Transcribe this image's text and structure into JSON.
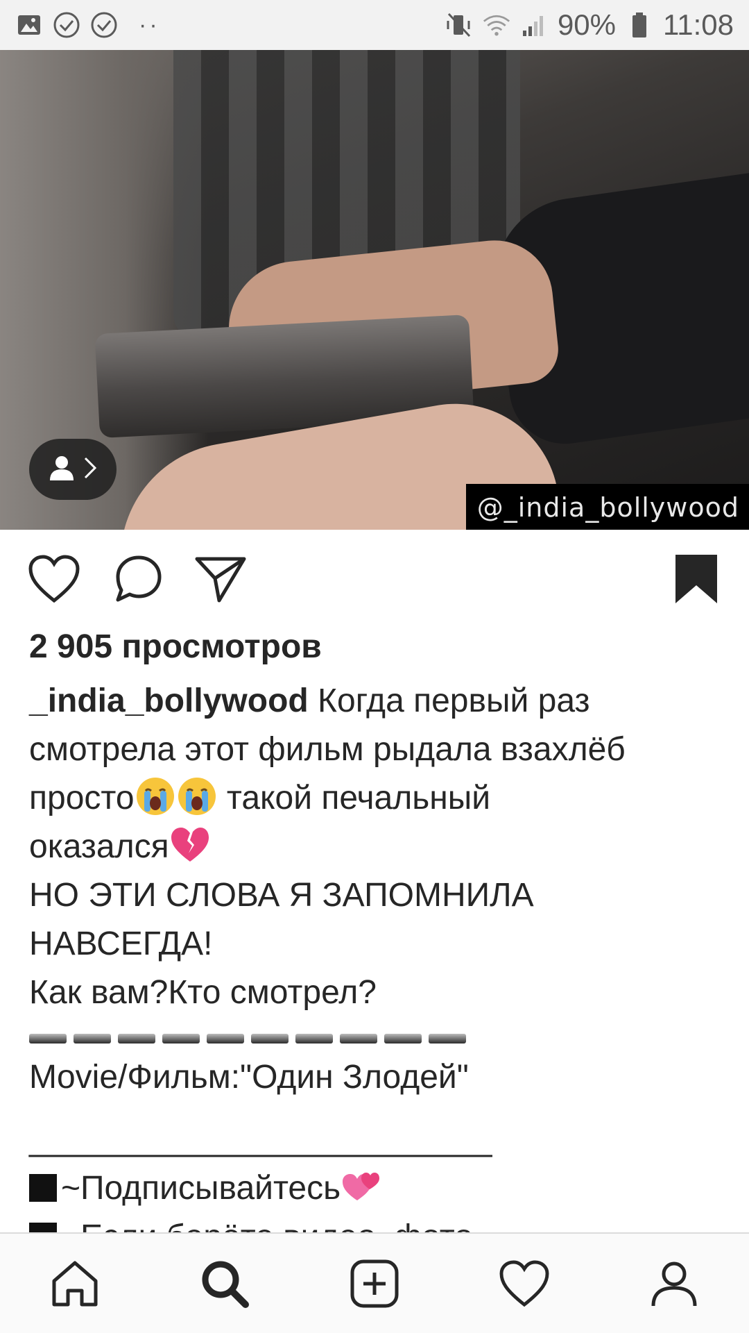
{
  "status_bar": {
    "battery": "90%",
    "time": "11:08",
    "left_icons": [
      "image-icon",
      "check-circle-icon",
      "check-circle-icon",
      "more-dots-icon"
    ],
    "right_icons": [
      "mute-vibrate-icon",
      "wifi-icon",
      "signal-icon",
      "battery-icon"
    ]
  },
  "post": {
    "watermark": "@_india_bollywood",
    "views": "2 905 просмотров",
    "username": "_india_bollywood",
    "caption_lines": [
      "Когда первый раз",
      "смотрела этот фильм рыдала взахлёб",
      "просто",
      " такой печальный",
      "оказался",
      "НО ЭТИ СЛОВА Я ЗАПОМНИЛА",
      "НАВСЕГДА!",
      "Как вам?Кто смотрел?",
      "Movie/Фильм:\"Один Злодей\"",
      "_________________________",
      "~Подписывайтесь",
      "~Если берёте видео, фото"
    ],
    "emojis": [
      "crying-face-emoji",
      "crying-face-emoji",
      "broken-heart-emoji",
      "hearts-emoji"
    ]
  },
  "actions": [
    "like-icon",
    "comment-icon",
    "share-icon",
    "bookmark-icon"
  ],
  "bottom_nav": [
    "home-icon",
    "search-icon",
    "add-post-icon",
    "activity-heart-icon",
    "profile-icon"
  ],
  "colors": {
    "text": "#262626",
    "status_bar_bg": "#f2f2f2",
    "nav_bg": "#fafafa"
  }
}
